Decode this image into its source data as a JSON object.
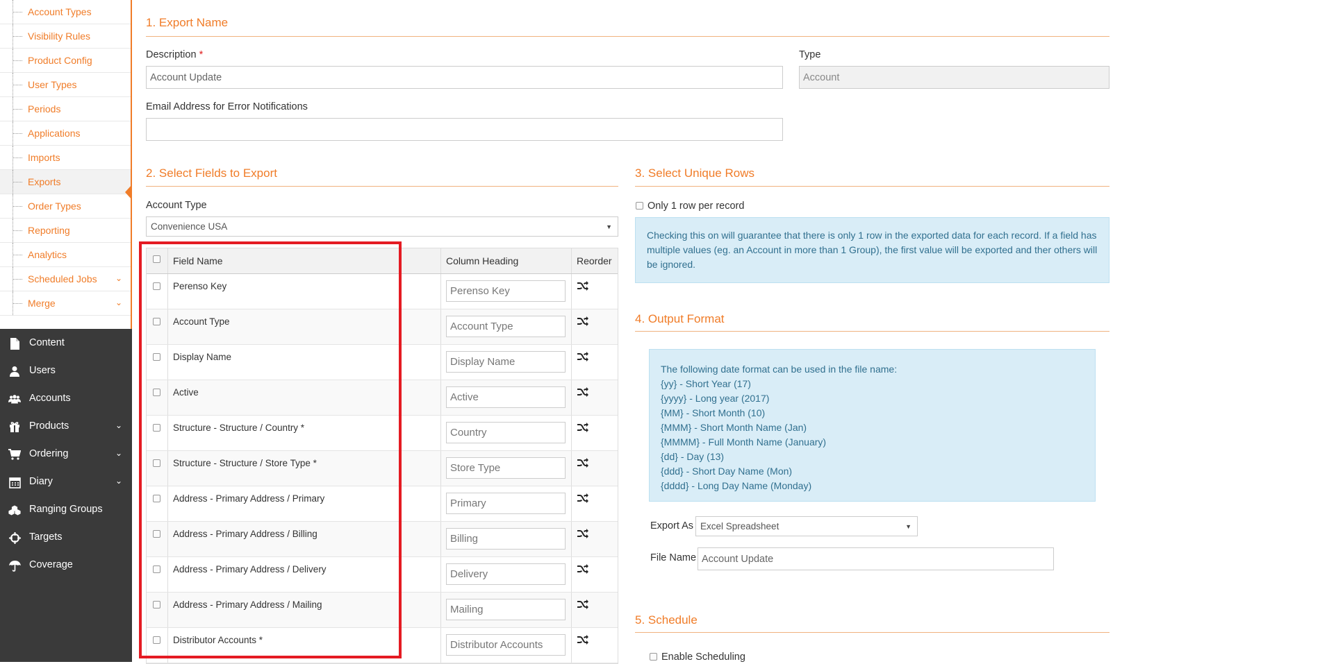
{
  "sidebar": {
    "sub_items": [
      {
        "label": "Account Types"
      },
      {
        "label": "Visibility Rules"
      },
      {
        "label": "Product Config"
      },
      {
        "label": "User Types"
      },
      {
        "label": "Periods"
      },
      {
        "label": "Applications"
      },
      {
        "label": "Imports"
      },
      {
        "label": "Exports"
      },
      {
        "label": "Order Types"
      },
      {
        "label": "Reporting"
      },
      {
        "label": "Analytics"
      },
      {
        "label": "Scheduled Jobs"
      },
      {
        "label": "Merge"
      }
    ],
    "main_items": [
      {
        "label": "Content",
        "icon": "document-icon"
      },
      {
        "label": "Users",
        "icon": "user-icon"
      },
      {
        "label": "Accounts",
        "icon": "users-group-icon"
      },
      {
        "label": "Products",
        "icon": "gift-icon"
      },
      {
        "label": "Ordering",
        "icon": "cart-icon"
      },
      {
        "label": "Diary",
        "icon": "calendar-icon"
      },
      {
        "label": "Ranging Groups",
        "icon": "cubes-icon"
      },
      {
        "label": "Targets",
        "icon": "crosshairs-icon"
      },
      {
        "label": "Coverage",
        "icon": "umbrella-icon"
      }
    ]
  },
  "export_name": {
    "title": "1. Export Name",
    "description_label": "Description",
    "required_mark": "*",
    "description_value": "Account Update",
    "type_label": "Type",
    "type_value": "Account",
    "email_label": "Email Address for Error Notifications",
    "email_value": ""
  },
  "select_fields": {
    "title": "2. Select Fields to Export",
    "account_type_label": "Account Type",
    "account_type_value": "Convenience USA",
    "headers": {
      "field_name": "Field Name",
      "column_heading": "Column Heading",
      "reorder": "Reorder"
    },
    "rows": [
      {
        "field": "Perenso Key",
        "heading": "Perenso Key"
      },
      {
        "field": "Account Type",
        "heading": "Account Type"
      },
      {
        "field": "Display Name",
        "heading": "Display Name"
      },
      {
        "field": "Active",
        "heading": "Active"
      },
      {
        "field": "Structure - Structure / Country *",
        "heading": "Country"
      },
      {
        "field": "Structure - Structure / Store Type *",
        "heading": "Store Type"
      },
      {
        "field": "Address - Primary Address / Primary",
        "heading": "Primary"
      },
      {
        "field": "Address - Primary Address / Billing",
        "heading": "Billing"
      },
      {
        "field": "Address - Primary Address / Delivery",
        "heading": "Delivery"
      },
      {
        "field": "Address - Primary Address / Mailing",
        "heading": "Mailing"
      },
      {
        "field": "Distributor Accounts *",
        "heading": "Distributor Accounts"
      }
    ]
  },
  "unique_rows": {
    "title": "3. Select Unique Rows",
    "checkbox_label": "Only 1 row per record",
    "info": "Checking this on will guarantee that there is only 1 row in the exported data for each record. If a field has multiple values (eg. an Account in more than 1 Group), the first value will be exported and ther others will be ignored."
  },
  "output_format": {
    "title": "4. Output Format",
    "info_lines": [
      "The following date format can be used in the file name:",
      "{yy} - Short Year (17)",
      "{yyyy} - Long year (2017)",
      "{MM} - Short Month (10)",
      "{MMM} - Short Month Name (Jan)",
      "{MMMM} - Full Month Name (January)",
      "{dd} - Day (13)",
      "{ddd} - Short Day Name (Mon)",
      "{dddd} - Long Day Name (Monday)"
    ],
    "export_as_label": "Export As",
    "export_as_value": "Excel Spreadsheet",
    "file_name_label": "File Name",
    "file_name_value": "Account Update"
  },
  "schedule": {
    "title": "5. Schedule",
    "enable_label": "Enable Scheduling"
  },
  "colors": {
    "accent": "#f07c28",
    "highlight": "#e41b23",
    "sidebar_dark": "#3a3a3a",
    "info_bg": "#d9edf7"
  }
}
